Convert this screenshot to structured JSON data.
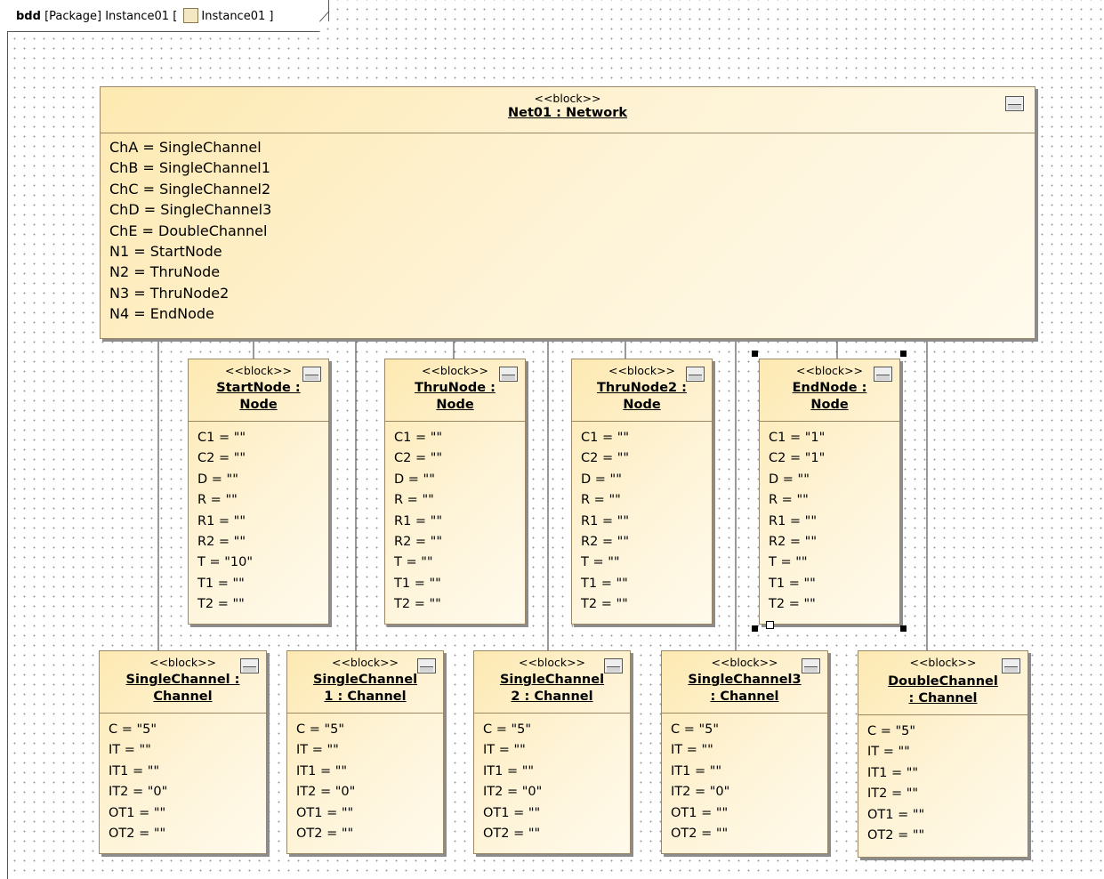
{
  "frame": {
    "kind": "bdd",
    "prefix": "[Package] Instance01 [",
    "inner": "Instance01",
    "suffix": "]",
    "icon": "instance-diagram-icon"
  },
  "network": {
    "stereotype": "<<block>>",
    "name": "Net01 : Network",
    "props": [
      "ChA = SingleChannel",
      "ChB = SingleChannel1",
      "ChC = SingleChannel2",
      "ChD = SingleChannel3",
      "ChE = DoubleChannel",
      "N1 = StartNode",
      "N2 = ThruNode",
      "N3 = ThruNode2",
      "N4 = EndNode"
    ]
  },
  "nodes": [
    {
      "stereotype": "<<block>>",
      "name1": "StartNode :",
      "name2": "Node",
      "props": [
        "C1 = \"\"",
        "C2 = \"\"",
        "D = \"\"",
        "R = \"\"",
        "R1 = \"\"",
        "R2 = \"\"",
        "T = \"10\"",
        "T1 = \"\"",
        "T2 = \"\""
      ]
    },
    {
      "stereotype": "<<block>>",
      "name1": "ThruNode :",
      "name2": "Node",
      "props": [
        "C1 = \"\"",
        "C2 = \"\"",
        "D = \"\"",
        "R = \"\"",
        "R1 = \"\"",
        "R2 = \"\"",
        "T = \"\"",
        "T1 = \"\"",
        "T2 = \"\""
      ]
    },
    {
      "stereotype": "<<block>>",
      "name1": "ThruNode2 :",
      "name2": "Node",
      "props": [
        "C1 = \"\"",
        "C2 = \"\"",
        "D = \"\"",
        "R = \"\"",
        "R1 = \"\"",
        "R2 = \"\"",
        "T = \"\"",
        "T1 = \"\"",
        "T2 = \"\""
      ]
    },
    {
      "stereotype": "<<block>>",
      "name1": "EndNode :",
      "name2": "Node",
      "props": [
        "C1 = \"1\"",
        "C2 = \"1\"",
        "D = \"\"",
        "R = \"\"",
        "R1 = \"\"",
        "R2 = \"\"",
        "T = \"\"",
        "T1 = \"\"",
        "T2 = \"\""
      ]
    }
  ],
  "channels": [
    {
      "stereotype": "<<block>>",
      "name1": "SingleChannel :",
      "name2": "Channel",
      "props": [
        "C = \"5\"",
        "IT = \"\"",
        "IT1 = \"\"",
        "IT2 = \"0\"",
        "OT1 = \"\"",
        "OT2 = \"\""
      ]
    },
    {
      "stereotype": "<<block>>",
      "name1": "SingleChannel",
      "name2": "1 : Channel",
      "props": [
        "C = \"5\"",
        "IT = \"\"",
        "IT1 = \"\"",
        "IT2 = \"0\"",
        "OT1 = \"\"",
        "OT2 = \"\""
      ]
    },
    {
      "stereotype": "<<block>>",
      "name1": "SingleChannel",
      "name2": "2 : Channel",
      "props": [
        "C = \"5\"",
        "IT = \"\"",
        "IT1 = \"\"",
        "IT2 = \"0\"",
        "OT1 = \"\"",
        "OT2 = \"\""
      ]
    },
    {
      "stereotype": "<<block>>",
      "name1": "SingleChannel3",
      "name2": ": Channel",
      "props": [
        "C = \"5\"",
        "IT = \"\"",
        "IT1 = \"\"",
        "IT2 = \"0\"",
        "OT1 = \"\"",
        "OT2 = \"\""
      ]
    },
    {
      "stereotype": "<<block>>",
      "name1": "DoubleChannel",
      "name2": ": Channel",
      "props": [
        "C = \"5\"",
        "IT = \"\"",
        "IT1 = \"\"",
        "IT2 = \"\"",
        "OT1 = \"\"",
        "OT2 = \"\""
      ]
    }
  ]
}
